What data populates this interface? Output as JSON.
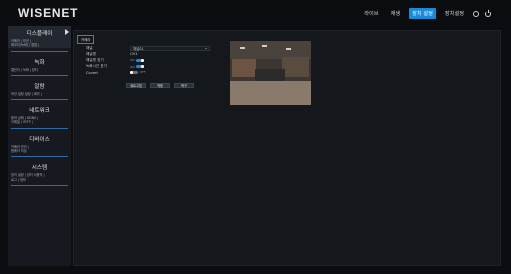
{
  "brand": {
    "logo": "WISENET"
  },
  "top_nav": {
    "items": [
      {
        "label": "라이브",
        "active": false
      },
      {
        "label": "재생",
        "active": false
      },
      {
        "label": "장치 설정",
        "active": true
      },
      {
        "label": "장치설정",
        "active": false
      }
    ],
    "icons": [
      "help-icon",
      "power-icon"
    ]
  },
  "sidebar": {
    "sections": [
      {
        "title": "디스플레이",
        "subs": [
          "카메라 | 모션 |",
          "레코더(녹화) | 팝업 |"
        ],
        "active": true
      },
      {
        "title": "녹화",
        "subs": [
          "캘린더 | 녹화 | 장치"
        ]
      },
      {
        "title": "알람",
        "subs": [
          "모션 설정 설정 | 제어 |"
        ]
      },
      {
        "title": "네트워크",
        "subs": [
          "동작 상태 | DDNS |",
          "이메일 | IP/TP |"
        ]
      },
      {
        "title": "디바이스",
        "subs": [
          "카메라 관리 |",
          "펌웨어 저장"
        ]
      },
      {
        "title": "시스템",
        "subs": [
          "장치 설정 | 장치 사용자 |",
          "로그 | 정보"
        ]
      }
    ]
  },
  "content": {
    "tab_label": "카메라",
    "form": {
      "rows": [
        {
          "label": "채널",
          "type": "select",
          "value": "채널01"
        },
        {
          "label": "채널명",
          "type": "text",
          "value": "CH1"
        },
        {
          "label": "채널명 표기",
          "type": "toggle",
          "value": "ON"
        },
        {
          "label": "녹화시간 표기",
          "type": "toggle",
          "value": "ON"
        },
        {
          "label": "Covert",
          "type": "toggle",
          "value": "OFF"
        }
      ]
    },
    "buttons": [
      {
        "label": "새로고침"
      },
      {
        "label": "적용"
      },
      {
        "label": "복구"
      }
    ]
  },
  "colors": {
    "accent": "#1b8ad6",
    "background": "#0c0d10",
    "panel": "#14171c",
    "sidebar": "#16191f"
  }
}
